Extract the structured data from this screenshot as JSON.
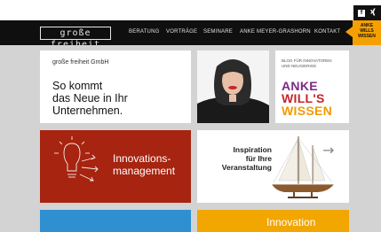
{
  "header": {
    "logo_text": "große freiheit",
    "nav": [
      "BERATUNG",
      "VORTRÄGE",
      "SEMINARE",
      "ANKE MEYER-GRASHORN",
      "KONTAKT"
    ],
    "badge": [
      "ANKE",
      "WILLS",
      "WISSEN"
    ],
    "social_icons": [
      "facebook-icon",
      "xing-icon"
    ],
    "facebook_glyph": "f"
  },
  "tiles": {
    "intro": {
      "company": "große freiheit GmbH",
      "headline": [
        "So kommt",
        "das Neue in Ihr",
        "Unternehmen."
      ]
    },
    "blog": {
      "caption": [
        "BLOG FÜR INNOVATOREN",
        "UND NEUGIERIGE"
      ],
      "title": [
        "ANKE",
        "WILL'S",
        "WISSEN"
      ],
      "colors": [
        "#7b2a86",
        "#c2262d",
        "#f29a00"
      ]
    },
    "innovation": {
      "label": [
        "Innovations-",
        "management"
      ]
    },
    "inspiration": {
      "label": [
        "Inspiration",
        "für Ihre",
        "Veranstaltung"
      ],
      "arrow": "→"
    },
    "orange": {
      "label": "Innovation"
    }
  },
  "colors": {
    "nav_bg": "#0f0f0f",
    "accent_orange": "#f5a000",
    "innovation_red": "#a62410",
    "blue": "#2e8fd1",
    "background_gray": "#d3d3d3"
  }
}
